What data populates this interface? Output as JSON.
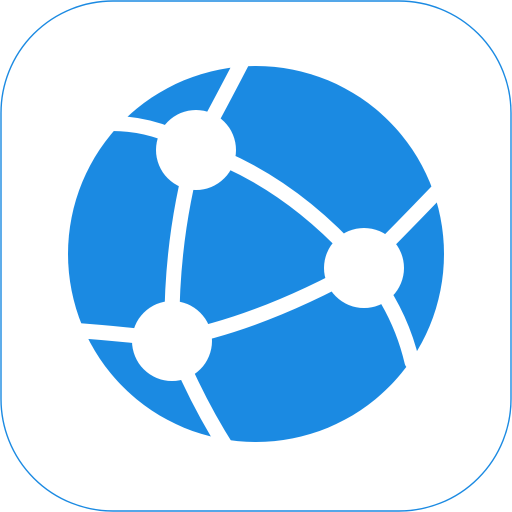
{
  "app_icon": {
    "icon_name": "network-globe-icon",
    "colors": {
      "background": "#ffffff",
      "tile_border": "#1b8ae2",
      "globe": "#1b8ae2",
      "network_lines": "#ffffff",
      "nodes": "#ffffff"
    }
  }
}
